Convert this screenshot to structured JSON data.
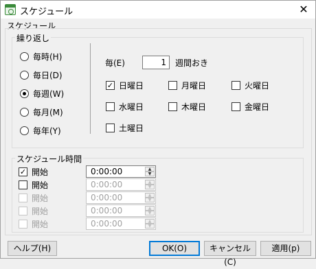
{
  "window": {
    "title": "スケジュール",
    "close_glyph": "✕"
  },
  "tab_label": "スケジュール",
  "repeat": {
    "legend": "繰り返し",
    "options": [
      {
        "label": "毎時(H)",
        "checked": false
      },
      {
        "label": "毎日(D)",
        "checked": false
      },
      {
        "label": "毎週(W)",
        "checked": true
      },
      {
        "label": "毎月(M)",
        "checked": false
      },
      {
        "label": "毎年(Y)",
        "checked": false
      }
    ],
    "every_label": "毎(E)",
    "every_value": "1",
    "weekly_suffix": "週間おき",
    "days": [
      {
        "label": "日曜日",
        "checked": true
      },
      {
        "label": "月曜日",
        "checked": false
      },
      {
        "label": "火曜日",
        "checked": false
      },
      {
        "label": "水曜日",
        "checked": false
      },
      {
        "label": "木曜日",
        "checked": false
      },
      {
        "label": "金曜日",
        "checked": false
      },
      {
        "label": "土曜日",
        "checked": false
      }
    ]
  },
  "schedule_time": {
    "legend": "スケジュール時間",
    "rows": [
      {
        "label": "開始",
        "checked": true,
        "enabled": true,
        "value": "0:00:00"
      },
      {
        "label": "開始",
        "checked": false,
        "enabled": true,
        "value": "0:00:00"
      },
      {
        "label": "開始",
        "checked": false,
        "enabled": false,
        "value": "0:00:00"
      },
      {
        "label": "開始",
        "checked": false,
        "enabled": false,
        "value": "0:00:00"
      },
      {
        "label": "開始",
        "checked": false,
        "enabled": false,
        "value": "0:00:00"
      }
    ]
  },
  "buttons": {
    "help": "ヘルプ(H)",
    "ok": "OK(O)",
    "cancel": "キャンセル(C)",
    "apply": "適用(p)"
  }
}
